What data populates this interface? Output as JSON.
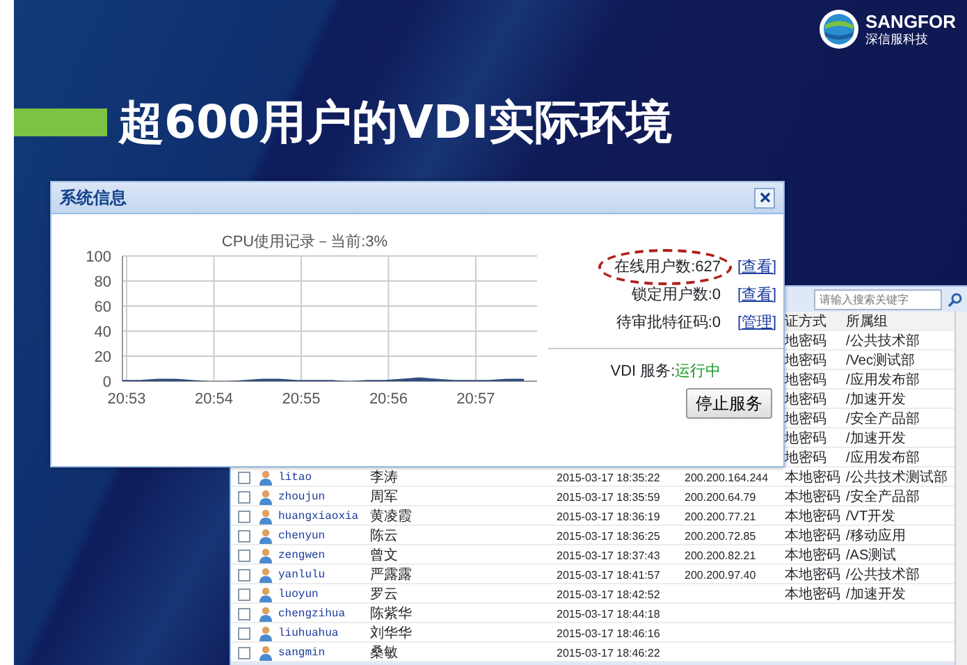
{
  "logo": {
    "brand": "SANGFOR",
    "subtitle": "深信服科技"
  },
  "slide_title": "超600用户的VDI实际环境",
  "user_list": {
    "search": {
      "placeholder": "请输入搜索关键字"
    },
    "columns": [
      "证方式",
      "所属组"
    ],
    "rows": [
      {
        "auth": "地密码",
        "group": "/公共技术部"
      },
      {
        "auth": "地密码",
        "group": "/Vec测试部"
      },
      {
        "auth": "地密码",
        "group": "/应用发布部"
      },
      {
        "auth": "地密码",
        "group": "/加速开发"
      },
      {
        "auth": "地密码",
        "group": "/安全产品部"
      },
      {
        "auth": "地密码",
        "group": "/加速开发"
      },
      {
        "auth": "地密码",
        "group": "/应用发布部"
      },
      {
        "checked": false,
        "username": "litao",
        "name": "李涛",
        "time": "2015-03-17 18:35:22",
        "ip": "200.200.164.244",
        "auth": "本地密码",
        "group": "/公共技术测试部"
      },
      {
        "checked": false,
        "username": "zhoujun",
        "name": "周军",
        "time": "2015-03-17 18:35:59",
        "ip": "200.200.64.79",
        "auth": "本地密码",
        "group": "/安全产品部"
      },
      {
        "checked": false,
        "username": "huangxiaoxia",
        "name": "黄凌霞",
        "time": "2015-03-17 18:36:19",
        "ip": "200.200.77.21",
        "auth": "本地密码",
        "group": "/VT开发"
      },
      {
        "checked": false,
        "username": "chenyun",
        "name": "陈云",
        "time": "2015-03-17 18:36:25",
        "ip": "200.200.72.85",
        "auth": "本地密码",
        "group": "/移动应用"
      },
      {
        "checked": false,
        "username": "zengwen",
        "name": "曾文",
        "time": "2015-03-17 18:37:43",
        "ip": "200.200.82.21",
        "auth": "本地密码",
        "group": "/AS测试"
      },
      {
        "checked": false,
        "username": "yanlulu",
        "name": "严露露",
        "time": "2015-03-17 18:41:57",
        "ip": "200.200.97.40",
        "auth": "本地密码",
        "group": "/公共技术部"
      },
      {
        "checked": false,
        "username": "luoyun",
        "name": "罗云",
        "time": "2015-03-17 18:42:52",
        "auth": "本地密码",
        "group": "/加速开发"
      },
      {
        "checked": false,
        "username": "chengzihua",
        "name": "陈紫华",
        "time": "2015-03-17 18:44:18"
      },
      {
        "checked": false,
        "username": "liuhuahua",
        "name": "刘华华",
        "time": "2015-03-17 18:46:16"
      },
      {
        "checked": false,
        "username": "sangmin",
        "name": "桑敏",
        "time": "2015-03-17 18:46:22"
      }
    ]
  },
  "dialog": {
    "title": "系统信息",
    "chart": {
      "chart_data": {
        "type": "area",
        "title": "CPU使用记录－当前:3%",
        "categories": [
          "20:53",
          null,
          null,
          null,
          null,
          "20:54",
          null,
          null,
          null,
          null,
          "20:55",
          null,
          null,
          null,
          null,
          "20:56",
          null,
          null,
          null,
          null,
          "20:57",
          null,
          null,
          null
        ],
        "values": [
          1,
          1,
          2,
          2,
          1,
          0,
          0,
          1,
          2,
          2,
          1,
          1,
          1,
          0,
          1,
          1,
          2,
          3,
          2,
          1,
          1,
          1,
          2,
          2
        ],
        "ylim": [
          0,
          100
        ],
        "grid": true,
        "yticks": [
          0,
          20,
          40,
          60,
          80,
          100
        ]
      }
    },
    "stats": [
      {
        "label": "在线用户数:627",
        "link": "[查看]",
        "highlighted": true
      },
      {
        "label": "锁定用户数:0",
        "link": "[查看]",
        "highlighted": false
      },
      {
        "label": "待审批特征码:0",
        "link": "[管理]",
        "highlighted": false
      }
    ],
    "service": {
      "label": "VDI 服务:",
      "status": "运行中",
      "running": true,
      "button": "停止服务"
    }
  }
}
